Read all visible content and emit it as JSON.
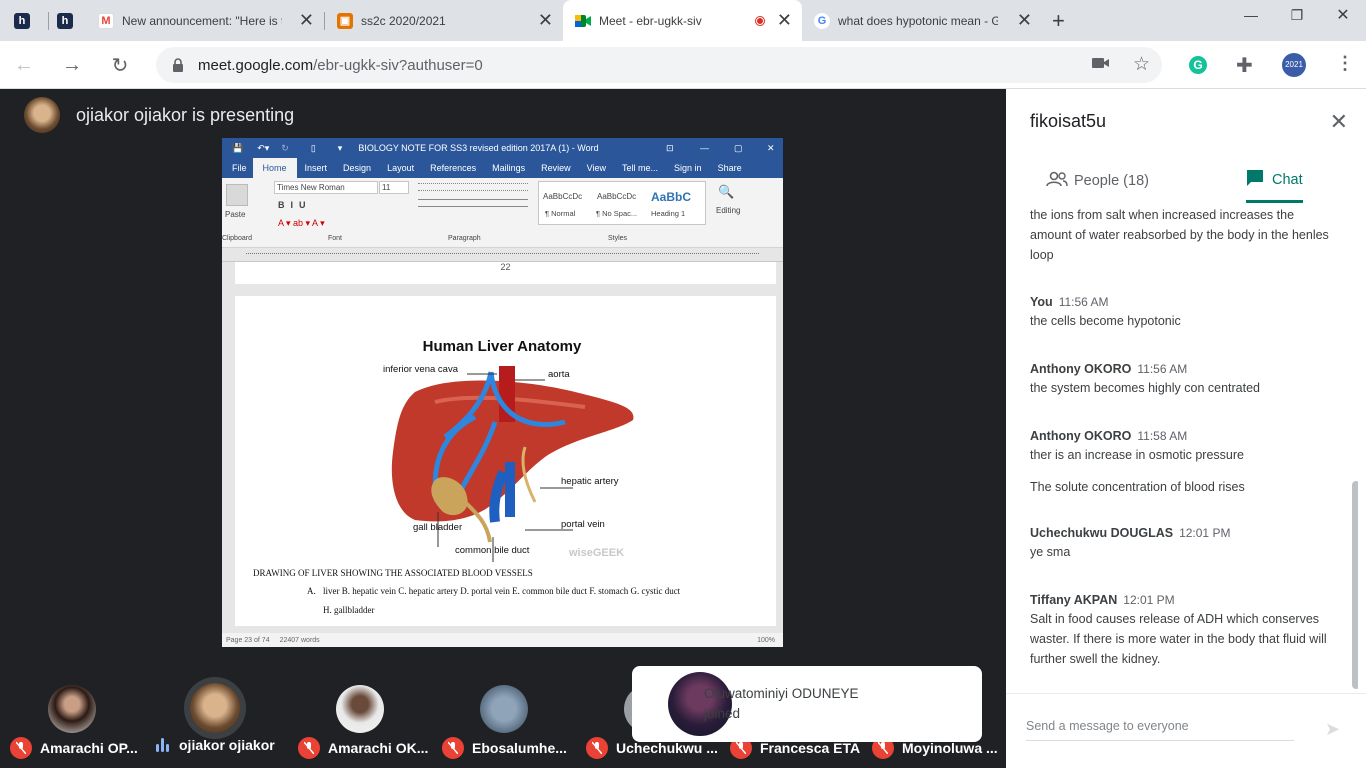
{
  "browser": {
    "tabs": [
      {
        "title": "",
        "icon": "h-icon",
        "color": "#1a2b4c"
      },
      {
        "title": "",
        "icon": "h-icon",
        "color": "#1a2b4c"
      },
      {
        "title": "New announcement: \"Here is t",
        "icon": "gmail-icon"
      },
      {
        "title": "ss2c 2020/2021",
        "icon": "classroom-icon",
        "color": "#e37400"
      },
      {
        "title": "Meet - ebr-ugkk-siv",
        "icon": "meet-icon"
      },
      {
        "title": "what does hypotonic mean - G",
        "icon": "google-icon"
      }
    ],
    "url_host": "meet.google.com",
    "url_path": "/ebr-ugkk-siv?authuser=0",
    "profile_badge": "2021"
  },
  "meet": {
    "presenter_text": "ojiakor ojiakor is presenting",
    "panel_title": "fikoisat5u",
    "people_tab": "People (18)",
    "chat_tab": "Chat",
    "compose_placeholder": "Send a message to everyone",
    "messages": [
      {
        "sender": "",
        "time": "",
        "text": "the ions from salt when increased increases the amount of water reabsorbed by the body in the henles loop"
      },
      {
        "sender": "You",
        "time": "11:56 AM",
        "text": "the cells become hypotonic"
      },
      {
        "sender": "Anthony OKORO",
        "time": "11:56 AM",
        "text": "the system becomes highly con centrated"
      },
      {
        "sender": "Anthony OKORO",
        "time": "11:58 AM",
        "text": "ther is an increase in osmotic pressure"
      },
      {
        "sender": "",
        "time": "",
        "text": "The solute concentration of blood rises"
      },
      {
        "sender": "Uchechukwu DOUGLAS",
        "time": "12:01 PM",
        "text": "ye sma"
      },
      {
        "sender": "Tiffany AKPAN",
        "time": "12:01 PM",
        "text": "Salt in food causes release of ADH which conserves waster. If there is more water in the body that fluid will further swell the kidney."
      }
    ],
    "toast": "Oluwatominiyi ODUNEYE joined",
    "participants": [
      {
        "name": "Amarachi OP...",
        "muted": true
      },
      {
        "name": "ojiakor ojiakor",
        "muted": false
      },
      {
        "name": "Amarachi OK...",
        "muted": true
      },
      {
        "name": "Ebosalumhe...",
        "muted": true
      },
      {
        "name": "Uchechukwu ...",
        "muted": true
      },
      {
        "name": "Francesca ETA",
        "muted": true
      },
      {
        "name": "Moyinoluwa ...",
        "muted": true
      }
    ]
  },
  "word": {
    "title": "BIOLOGY NOTE  FOR SS3 revised edition 2017A (1) - Word",
    "menu": [
      "File",
      "Home",
      "Insert",
      "Design",
      "Layout",
      "References",
      "Mailings",
      "Review",
      "View",
      "Tell me...",
      "Sign in",
      "Share"
    ],
    "font_name": "Times New Roman",
    "font_size": "11",
    "styles": [
      {
        "preview": "AaBbCcDc",
        "name": "¶ Normal"
      },
      {
        "preview": "AaBbCcDc",
        "name": "¶ No Spac..."
      },
      {
        "preview": "AaBbC",
        "name": "Heading 1"
      }
    ],
    "groups": [
      "Clipboard",
      "Font",
      "Paragraph",
      "Styles"
    ],
    "editing": "Editing",
    "paste": "Paste",
    "page_number": "22",
    "figure_title": "Human Liver Anatomy",
    "labels": {
      "ivc": "inferior vena cava",
      "aorta": "aorta",
      "hepatic_artery": "hepatic artery",
      "portal_vein": "portal vein",
      "gall_bladder": "gall bladder",
      "bile_duct": "common bile duct",
      "watermark": "wiseGEEK"
    },
    "caption": "DRAWING OF LIVER SHOWING THE ASSOCIATED BLOOD VESSELS",
    "list_marker": "A.",
    "list_text": "liver B. hepatic vein C. hepatic artery D. portal vein E. common bile duct F. stomach G. cystic duct",
    "list_text2": "H. gallbladder",
    "status_page": "Page 23 of 74",
    "status_words": "22407 words",
    "status_zoom": "100%"
  }
}
